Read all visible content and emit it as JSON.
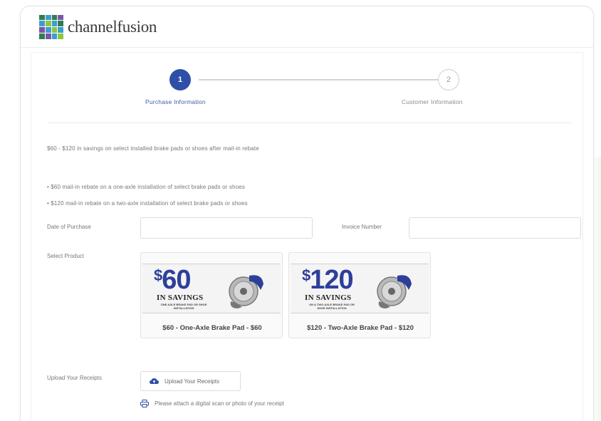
{
  "brand": {
    "name": "channelfusion",
    "colors": [
      "#2e7d4f",
      "#3c9dd1",
      "#7a56a8",
      "#8dc63f"
    ]
  },
  "stepper": {
    "steps": [
      {
        "number": "1",
        "label": "Purchase Information",
        "active": true
      },
      {
        "number": "2",
        "label": "Customer Information",
        "active": false
      }
    ],
    "accent": "#2e4fa7"
  },
  "offer": {
    "headline": "$60 - $120 in savings on select installed brake pads or shoes after mail-in rebate",
    "bullets": [
      "• $60 mail-in rebate on a one-axle installation of select brake pads or shoes",
      "• $120 mail-in rebate on a two-axle installation of select brake pads or shoes"
    ]
  },
  "form": {
    "date_label": "Date of Purchase",
    "date_value": "",
    "invoice_label": "Invoice Number",
    "invoice_value": "",
    "product_label": "Select Product",
    "products": [
      {
        "amount": "60",
        "savings": "IN SAVINGS",
        "fine": "ONE-AXLE BRAKE PAD OR SHOE INSTALLATION",
        "caption": "$60 - One-Axle Brake Pad - $60"
      },
      {
        "amount": "120",
        "savings": "IN SAVINGS",
        "fine": "ON A TWO-AXLE BRAKE PAD OR SHOE INSTALLATION",
        "caption": "$120 - Two-Axle Brake Pad - $120"
      }
    ],
    "upload_label": "Upload Your Receipts",
    "upload_button": "Upload Your Receipts",
    "upload_hint": "Please attach a digital scan or photo of your receipt"
  }
}
